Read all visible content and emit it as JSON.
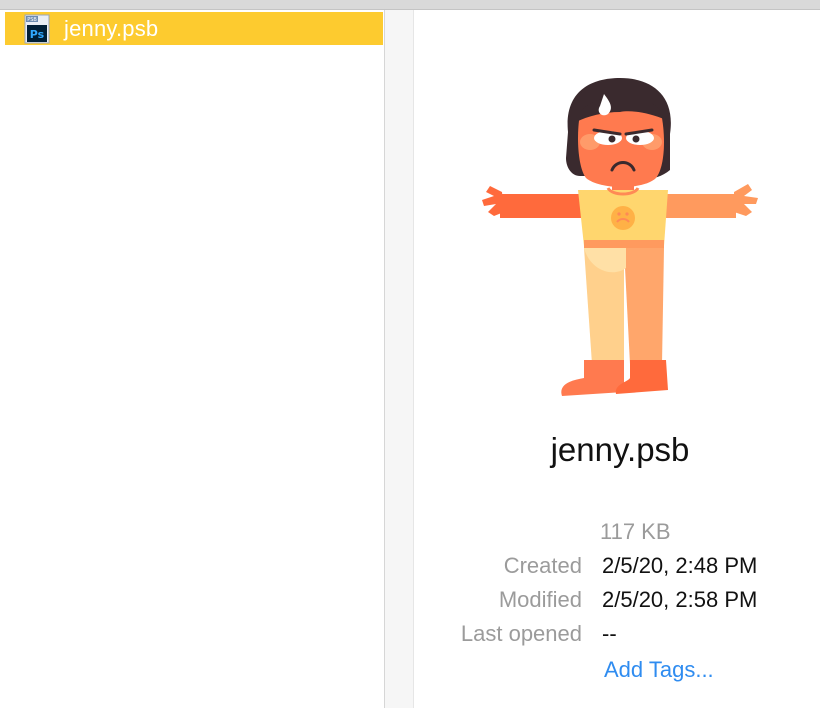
{
  "file_list": {
    "selected_file": "jenny.psb",
    "file_icon_badge": "PSB",
    "file_icon_letters": "Ps",
    "file_icon": "photoshop-document-icon"
  },
  "preview": {
    "thumbnail": "character-illustration",
    "title": "jenny.psb",
    "size": "117 KB",
    "created_label": "Created",
    "created_value": "2/5/20, 2:48 PM",
    "modified_label": "Modified",
    "modified_value": "2/5/20, 2:58 PM",
    "last_opened_label": "Last opened",
    "last_opened_value": "--",
    "add_tags": "Add Tags..."
  },
  "colors": {
    "selection": "#fdcb2f",
    "link": "#2f8cf0",
    "secondary_text": "#9b9b9b"
  }
}
